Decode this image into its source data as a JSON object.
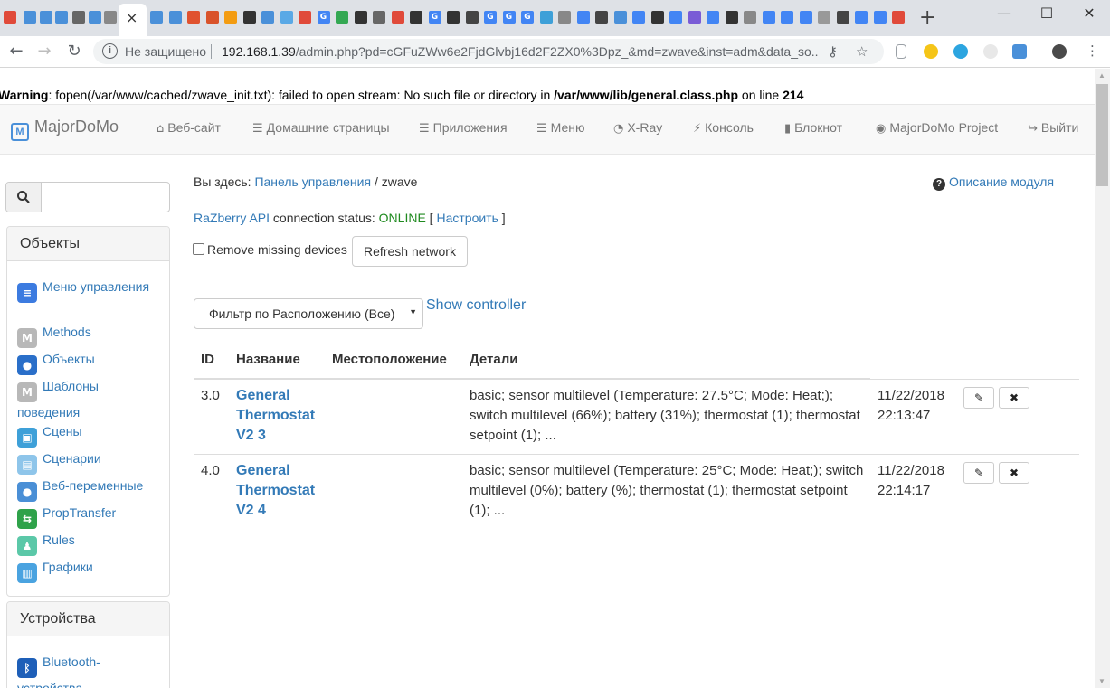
{
  "browser": {
    "active_tab_close": "×",
    "new_tab": "+",
    "window_controls": {
      "minimize": "—",
      "maximize": "☐",
      "close": "✕"
    },
    "nav": {
      "back": "←",
      "forward": "→",
      "reload": "↻"
    },
    "omnibox": {
      "info_icon": "i",
      "security_label": "Не защищено",
      "url_host": "192.168.1.39",
      "url_path": "/admin.php?pd=cGFuZWw6e2FjdGlvbj16d2F2ZX0%3Dpz_&md=zwave&inst=adm&data_so..."
    },
    "tab_favicons": [
      "G",
      "G",
      "G",
      "G",
      "G",
      "G",
      "G",
      "G",
      "G",
      "G",
      "G",
      "G",
      "G",
      "G"
    ]
  },
  "warning": {
    "prefix": "Warning",
    "message": ": fopen(/var/www/cached/zwave_init.txt): failed to open stream: No such file or directory in ",
    "file": "/var/www/lib/general.class.php",
    "mid": " on line ",
    "line": "214"
  },
  "navbar": {
    "brand": "MajorDoMo",
    "brand_logo": "M",
    "items": [
      {
        "icon": "⌂",
        "label": "Веб-сайт"
      },
      {
        "icon": "☰",
        "label": "Домашние страницы"
      },
      {
        "icon": "☰",
        "label": "Приложения"
      },
      {
        "icon": "☰",
        "label": "Меню"
      },
      {
        "icon": "◔",
        "label": "X-Ray"
      },
      {
        "icon": "⚡",
        "label": "Консоль"
      },
      {
        "icon": "▮",
        "label": "Блокнот"
      },
      {
        "icon": "◉",
        "label": "MajorDoMo Project"
      },
      {
        "icon": "↪",
        "label": "Выйти"
      }
    ]
  },
  "sidebar": {
    "search_value": "",
    "objects_heading": "Объекты",
    "objects_items": [
      {
        "label": "Меню управления",
        "icon": "menu-icon",
        "color": "#3c7be0",
        "glyph": "≡"
      },
      {
        "label": "Methods",
        "icon": "methods-icon",
        "color": "#b8b8b8",
        "glyph": "M"
      },
      {
        "label": "Объекты",
        "icon": "globe-icon",
        "color": "#2a6fc9",
        "glyph": "●"
      },
      {
        "label": "Шаблоны поведения",
        "icon": "templates-icon",
        "color": "#b8b8b8",
        "glyph": "M"
      },
      {
        "label": "Сцены",
        "icon": "scenes-icon",
        "color": "#3ea0d8",
        "glyph": "▣"
      },
      {
        "label": "Сценарии",
        "icon": "scripts-icon",
        "color": "#8ec5ea",
        "glyph": "▤"
      },
      {
        "label": "Веб-переменные",
        "icon": "web-vars-icon",
        "color": "#4a8fd6",
        "glyph": "●"
      },
      {
        "label": "PropTransfer",
        "icon": "prop-transfer-icon",
        "color": "#2fa24a",
        "glyph": "⇆"
      },
      {
        "label": "Rules",
        "icon": "rules-icon",
        "color": "#5bc8a8",
        "glyph": "♟"
      },
      {
        "label": "Графики",
        "icon": "charts-icon",
        "color": "#4aa3e0",
        "glyph": "▥"
      }
    ],
    "devices_heading": "Устройства",
    "devices_items": [
      {
        "label": "Bluetooth-устройства",
        "icon": "bluetooth-icon",
        "color": "#1e5fb8",
        "glyph": "ᛒ"
      }
    ]
  },
  "content": {
    "breadcrumb_prefix": "Вы здесь: ",
    "breadcrumb_link": "Панель управления",
    "breadcrumb_sep": " / ",
    "breadcrumb_current": "zwave",
    "help_label": "Описание модуля",
    "api_label": "RaZberry API",
    "status_text": " connection status: ",
    "status_value": "ONLINE",
    "bracket_open": " [ ",
    "configure_label": "Настроить",
    "bracket_close": " ]",
    "remove_missing_label": "Remove missing devices",
    "refresh_button": "Refresh network",
    "location_filter": "Фильтр по Расположению (Все)",
    "show_controller": "Show controller"
  },
  "table": {
    "headers": {
      "id": "ID",
      "name": "Название",
      "location": "Местоположение",
      "details": "Детали"
    },
    "rows": [
      {
        "id": "3.0",
        "name": "General Thermostat V2 3",
        "location": "",
        "details": "basic; sensor multilevel (Temperature: 27.5°C; Mode: Heat;); switch multilevel (66%); battery (31%); thermostat (1); thermostat setpoint (1); ...",
        "date": "11/22/2018",
        "time": "22:13:47"
      },
      {
        "id": "4.0",
        "name": "General Thermostat V2 4",
        "location": "",
        "details": "basic; sensor multilevel (Temperature: 25°C; Mode: Heat;); switch multilevel (0%); battery (%); thermostat (1); thermostat setpoint (1); ...",
        "date": "11/22/2018",
        "time": "22:14:17"
      }
    ]
  }
}
